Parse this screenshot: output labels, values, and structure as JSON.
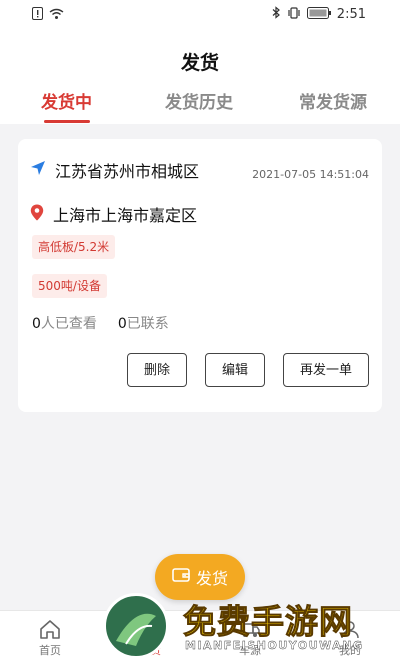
{
  "status_bar": {
    "time": "2:51"
  },
  "header": {
    "title": "发货",
    "tabs": [
      {
        "label": "发货中",
        "active": true
      },
      {
        "label": "发货历史",
        "active": false
      },
      {
        "label": "常发货源",
        "active": false
      }
    ]
  },
  "shipment": {
    "origin": "江苏省苏州市相城区",
    "timestamp": "2021-07-05 14:51:04",
    "destination": "上海市上海市嘉定区",
    "vehicle_tag": "高低板/5.2米",
    "cargo_tag": "500吨/设备",
    "views_count": "0",
    "views_label": "人已查看",
    "contacts_count": "0",
    "contacts_label": "已联系",
    "buttons": {
      "delete": "删除",
      "edit": "编辑",
      "repost": "再发一单"
    }
  },
  "fab": {
    "label": "发货"
  },
  "bottom_nav": {
    "home": "首页",
    "item2": "发货",
    "item3": "车源",
    "item4": "我的"
  },
  "watermark": {
    "title": "免费手游网",
    "subtitle": "MIANFEISHOUYOUWANG"
  },
  "colors": {
    "accent": "#d83a34",
    "fab": "#f3a922",
    "tag_bg": "#fdecea"
  }
}
